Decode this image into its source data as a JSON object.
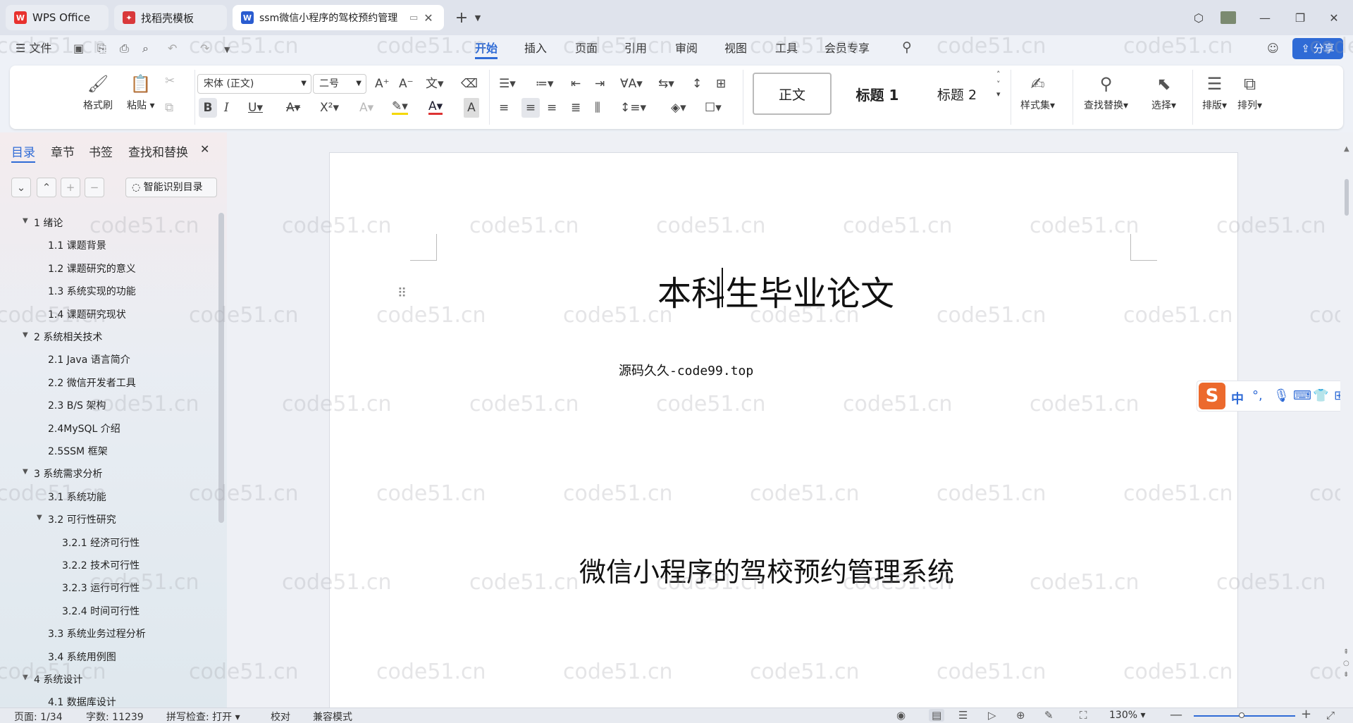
{
  "tabs": [
    {
      "label": "WPS Office",
      "icon": "wps-logo-icon"
    },
    {
      "label": "找稻壳模板",
      "icon": "docer-icon"
    },
    {
      "label": "ssm微信小程序的驾校预约管理",
      "icon": "word-doc-icon"
    }
  ],
  "menu": {
    "file": "文件",
    "items": [
      "开始",
      "插入",
      "页面",
      "引用",
      "审阅",
      "视图",
      "工具",
      "会员专享"
    ],
    "selected": "开始",
    "share": "分享"
  },
  "ribbon": {
    "format_painter": "格式刷",
    "paste": "粘贴",
    "font_name": "宋体 (正文)",
    "font_size": "二号",
    "styles": [
      "正文",
      "标题 1",
      "标题 2"
    ],
    "style_set": "样式集",
    "find_replace": "查找替换",
    "select": "选择",
    "layout": "排版",
    "arrange": "排列"
  },
  "nav": {
    "tabs": [
      "目录",
      "章节",
      "书签",
      "查找和替换"
    ],
    "smart_toc": "智能识别目录",
    "toc": [
      {
        "level": 1,
        "label": "1  绪论",
        "expanded": true
      },
      {
        "level": 2,
        "label": "1.1 课题背景"
      },
      {
        "level": 2,
        "label": "1.2 课题研究的意义"
      },
      {
        "level": 2,
        "label": "1.3  系统实现的功能"
      },
      {
        "level": 2,
        "label": "1.4 课题研究现状"
      },
      {
        "level": 1,
        "label": "2 系统相关技术",
        "expanded": true
      },
      {
        "level": 2,
        "label": "2.1 Java 语言简介"
      },
      {
        "level": 2,
        "label": "2.2 微信开发者工具"
      },
      {
        "level": 2,
        "label": "2.3 B/S 架构"
      },
      {
        "level": 2,
        "label": "2.4MySQL  介绍"
      },
      {
        "level": 2,
        "label": "2.5SSM 框架"
      },
      {
        "level": 1,
        "label": "3 系统需求分析",
        "expanded": true
      },
      {
        "level": 2,
        "label": "3.1 系统功能"
      },
      {
        "level": 2,
        "label": "3.2 可行性研究",
        "expanded": true
      },
      {
        "level": 3,
        "label": "3.2.1  经济可行性"
      },
      {
        "level": 3,
        "label": "3.2.2  技术可行性"
      },
      {
        "level": 3,
        "label": "3.2.3  运行可行性"
      },
      {
        "level": 3,
        "label": "3.2.4  时间可行性"
      },
      {
        "level": 2,
        "label": "3.3 系统业务过程分析"
      },
      {
        "level": 2,
        "label": "3.4 系统用例图"
      },
      {
        "level": 1,
        "label": "4 系统设计",
        "expanded": true
      },
      {
        "level": 2,
        "label": "4.1 数据库设计"
      }
    ]
  },
  "document": {
    "title": "本科生毕业论文",
    "source": "源码久久-code99.top",
    "subtitle": "微信小程序的驾校预约管理系统"
  },
  "watermark": "code51.cn",
  "ime": {
    "mode": "中"
  },
  "status": {
    "page": "页面: 1/34",
    "words": "字数: 11239",
    "spell": "拼写检查: 打开",
    "proof": "校对",
    "compat": "兼容模式",
    "zoom": "130%"
  }
}
